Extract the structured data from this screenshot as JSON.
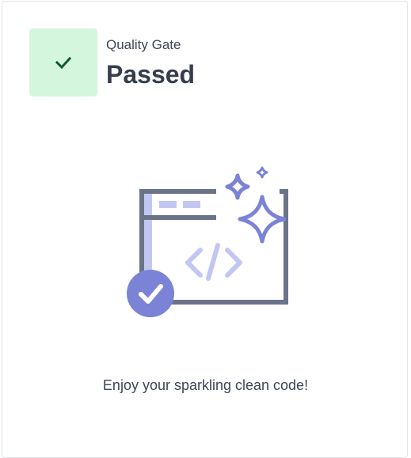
{
  "quality_gate": {
    "label": "Quality Gate",
    "status": "Passed",
    "status_color": "#d4f6dc",
    "check_color": "#115730",
    "icon": "check-icon"
  },
  "illustration": {
    "icon": "sparkling-clean-code-illustration",
    "frame_color": "#6b7389",
    "accent_color": "#7b83d7",
    "light_accent_color": "#c2c7f2"
  },
  "message": "Enjoy your sparkling clean code!"
}
